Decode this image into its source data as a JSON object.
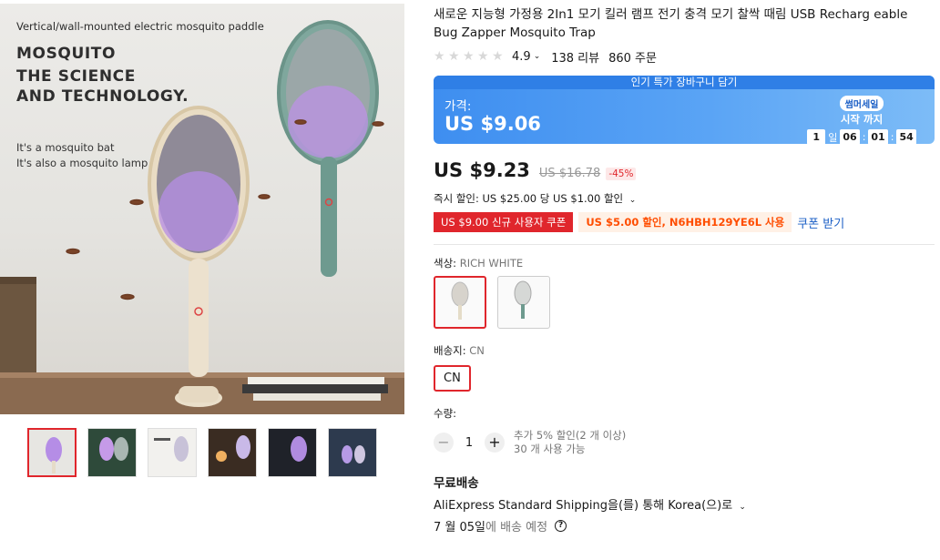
{
  "hero": {
    "top_caption": "Vertical/wall-mounted electric mosquito paddle",
    "headline_1": "MOSQUITO",
    "headline_2": "THE SCIENCE",
    "headline_3": "AND TECHNOLOGY.",
    "sub_1": "It's a mosquito bat",
    "sub_2": "It's also a mosquito lamp"
  },
  "thumbnails": [
    "thumb-1",
    "thumb-2",
    "thumb-3",
    "thumb-4",
    "thumb-5",
    "thumb-6"
  ],
  "product": {
    "title": "새로운 지능형 가정용 2In1 모기 킬러 램프 전기 충격 모기 찰싹 때림 USB Recharg eable Bug Zapper Mosquito Trap",
    "rating": "4.9",
    "reviews": "138 리뷰",
    "orders": "860 주문"
  },
  "promo": {
    "banner": "인기 특가 장바구니 담기",
    "label": "가격:",
    "price": "US $9.06",
    "badge": "썸머세일",
    "start_label": "시작 까지",
    "days": "1",
    "day_unit": "일",
    "hours": "06",
    "minutes": "01",
    "seconds": "54"
  },
  "price": {
    "current": "US $9.23",
    "original": "US $16.78",
    "discount": "-45%"
  },
  "instant_discount": "즉시 할인: US $25.00 당 US $1.00 할인",
  "coupons": {
    "new_user": "US $9.00 신규 사용자 쿠폰",
    "code": "US $5.00 할인, N6HBH129YE6L 사용",
    "get": "쿠폰 받기"
  },
  "color": {
    "label": "색상:",
    "value": "RICH WHITE"
  },
  "ship_from": {
    "label": "배송지:",
    "value": "CN",
    "option": "CN"
  },
  "quantity": {
    "label": "수량:",
    "value": "1",
    "minus": "−",
    "plus": "+",
    "note_1": "추가 5% 할인(2 개 이상)",
    "note_2": "30 개 사용 가능"
  },
  "shipping": {
    "free": "무료배송",
    "method": "AliExpress Standard Shipping을(를) 통해 Korea(으)로",
    "date": "7 월 05일",
    "date_suffix": "에 배송 예정"
  },
  "colors": {
    "accent_red": "#e0262c",
    "promo_blue": "#3e8ef0",
    "link_blue": "#1b5fc6",
    "coupon_orange": "#ff4d00"
  }
}
